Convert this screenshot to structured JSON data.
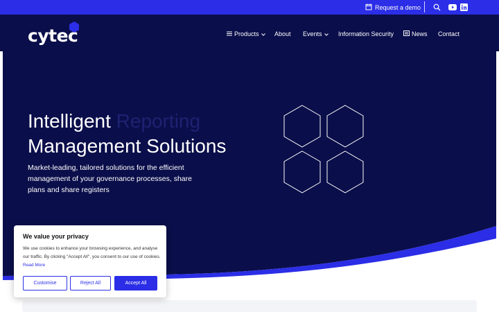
{
  "topbar": {
    "request_demo": "Request a demo",
    "icons": [
      "calendar-icon",
      "search-icon",
      "youtube-icon",
      "linkedin-icon"
    ]
  },
  "nav": {
    "logo_text": "cytec",
    "items": [
      {
        "label": "Products",
        "has_menu_icon": true,
        "has_chevron": true
      },
      {
        "label": "About"
      },
      {
        "label": "Events",
        "has_chevron": true
      },
      {
        "label": "Information Security"
      },
      {
        "label": "News",
        "has_news_icon": true
      },
      {
        "label": "Contact"
      }
    ]
  },
  "hero": {
    "title_line1_strong": "Intelligent",
    "title_line1_faded": "Reporting",
    "title_line2": "Management Solutions",
    "subtitle": "Market-leading, tailored solutions for the efficient management of your governance processes, share plans and share registers"
  },
  "cookie": {
    "title": "We value your privacy",
    "body": "We use cookies to enhance your browsing experience, and analyse our traffic. By clicking \"Accept All\", you consent to our use of cookies.",
    "read_more": "Read More",
    "buttons": {
      "customise": "Customise",
      "reject": "Reject All",
      "accept": "Accept All"
    }
  },
  "colors": {
    "brand_blue": "#2b2ee6",
    "navy": "#0a0e4a",
    "faded_text": "#1e2272"
  }
}
